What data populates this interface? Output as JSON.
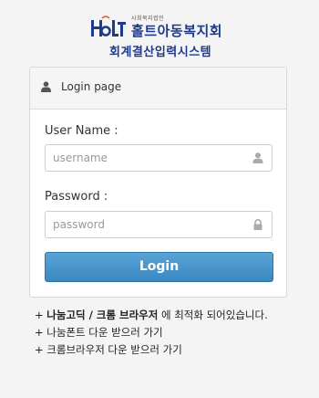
{
  "logo": {
    "mark_text": "HOLT",
    "small_text": "사회복지법인",
    "name": "홀트아동복지회",
    "subtitle": "회계결산입력시스템"
  },
  "panel": {
    "icon": "user-icon",
    "title": "Login page"
  },
  "form": {
    "username_label": "User Name :",
    "username_placeholder": "username",
    "username_icon": "user-icon",
    "password_label": "Password :",
    "password_placeholder": "password",
    "password_icon": "lock-icon",
    "login_label": "Login"
  },
  "notes": {
    "line1_prefix": "+ ",
    "line1_bold": "나눔고딕 / 크롬 브라우저",
    "line1_rest": " 에 최적화 되어있습니다.",
    "line2": "+ 나눔폰트 다운 받으러 가기",
    "line3": "+ 크롬브라우저 다운 받으러 가기"
  },
  "colors": {
    "brand": "#1d3a8c",
    "button": "#3b87c0"
  }
}
